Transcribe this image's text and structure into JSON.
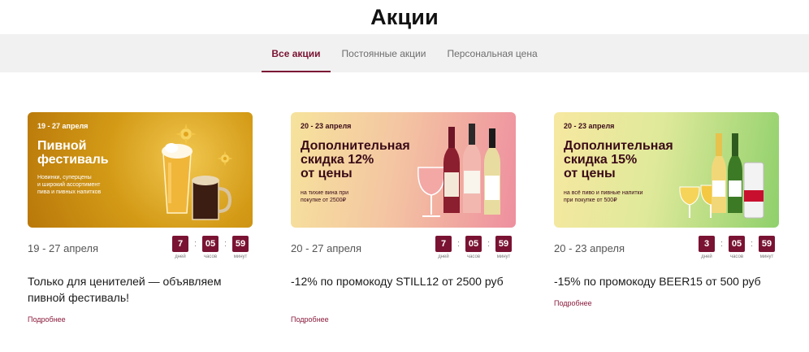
{
  "page": {
    "title": "Акции"
  },
  "tabs": [
    {
      "label": "Все акции",
      "active": true
    },
    {
      "label": "Постоянные акции",
      "active": false
    },
    {
      "label": "Персональная цена",
      "active": false
    }
  ],
  "colors": {
    "accent": "#7a1333",
    "link": "#8a1a3c",
    "tab_bar": "#f1f1f1"
  },
  "promos": [
    {
      "banner": {
        "date": "19 - 27 апреля",
        "title_line1": "Пивной",
        "title_line2": "фестиваль",
        "subtitle_line1": "Новинки, суперцены",
        "subtitle_line2": "и широкий ассортимент",
        "subtitle_line3": "пива и пивных напитков",
        "icons": [
          "beer-glass-icon",
          "beer-mug-icon",
          "hop-icon"
        ]
      },
      "date_range": "19 - 27 апреля",
      "timer": {
        "days": "7",
        "hours": "05",
        "minutes": "59"
      },
      "description": "Только для ценителей — объявляем пивной фестиваль!",
      "more_link": "Подробнее"
    },
    {
      "banner": {
        "date": "20 - 23 апреля",
        "title_line1": "Дополнительная",
        "title_line2": "скидка 12%",
        "title_line3": "от цены",
        "subtitle_line1": "на тихие вина при",
        "subtitle_line2": "покупке от 2500₽",
        "icons": [
          "wine-glass-icon",
          "wine-bottle-icon"
        ]
      },
      "date_range": "20 - 27 апреля",
      "timer": {
        "days": "7",
        "hours": "05",
        "minutes": "59"
      },
      "description": "-12% по промокоду STILL12 от 2500 руб",
      "more_link": "Подробнее"
    },
    {
      "banner": {
        "date": "20 - 23 апреля",
        "title_line1": "Дополнительная",
        "title_line2": "скидка 15%",
        "title_line3": "от цены",
        "subtitle_line1": "на всё пиво и пивные напитки",
        "subtitle_line2": "при покупке от 500₽",
        "icons": [
          "beer-glass-icon",
          "beer-bottle-icon",
          "beer-can-icon"
        ]
      },
      "date_range": "20 - 23 апреля",
      "timer": {
        "days": "3",
        "hours": "05",
        "minutes": "59"
      },
      "description": "-15% по промокоду BEER15 от 500 руб",
      "more_link": "Подробнее"
    }
  ],
  "timer_labels": {
    "days": "дней",
    "hours": "часов",
    "minutes": "минут"
  }
}
